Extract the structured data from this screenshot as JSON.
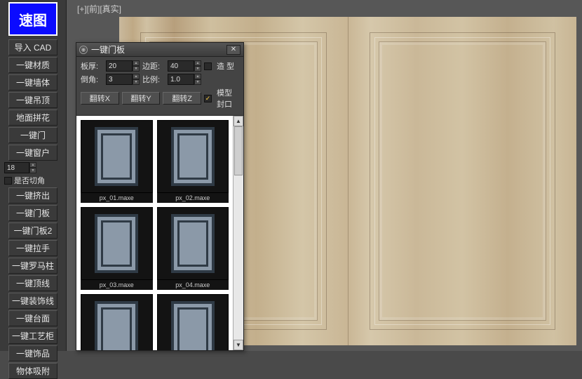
{
  "logo_text": "速图",
  "viewport_label": "[+][前][真实]",
  "sidebar": {
    "buttons_top": [
      "导入 CAD",
      "一键材质",
      "一键墙体",
      "一键吊顶",
      "地面拼花",
      "一键门",
      "一键窗户"
    ],
    "spinner_value": "18",
    "checkbox_label": "是否切角",
    "buttons_bottom": [
      "一键挤出",
      "一键门板",
      "一键门板2",
      "一键拉手",
      "一键罗马柱",
      "一键顶线",
      "一键装饰线",
      "一键台面",
      "一键工艺柜",
      "一键饰品",
      "物体吸附"
    ]
  },
  "dialog": {
    "title": "一键门板",
    "labels": {
      "thickness": "板厚:",
      "margin": "边距:",
      "shape": "造 型",
      "chamfer": "倒角:",
      "ratio": "比例:"
    },
    "values": {
      "thickness": "20",
      "margin": "40",
      "chamfer": "3",
      "ratio": "1.0"
    },
    "flip": {
      "x": "翻转X",
      "y": "翻转Y",
      "z": "翻转Z"
    },
    "seal_label": "模型封口",
    "thumbs": [
      "px_01.maxe",
      "px_02.maxe",
      "px_03.maxe",
      "px_04.maxe",
      "",
      ""
    ]
  }
}
